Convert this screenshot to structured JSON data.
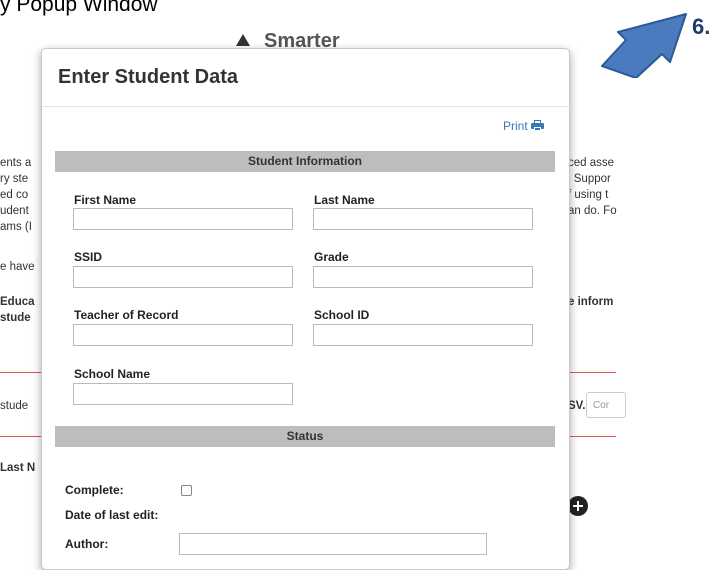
{
  "caption": "y Popup Window",
  "callout": {
    "number": "6."
  },
  "background": {
    "logo": "Smarter",
    "left_fragments": [
      "ents a",
      "ry ste",
      "ed co",
      "udent",
      "ams (I",
      "e have",
      "Educa",
      "stude",
      "stude",
      "Last N"
    ],
    "right_fragments": [
      "ced asse",
      "l Suppor",
      "f using t",
      "an do. Fo",
      "e inform",
      "SV."
    ],
    "input_value": "Cor"
  },
  "modal": {
    "title": "Enter Student Data",
    "print_label": "Print",
    "sections": {
      "student_info": "Student Information",
      "status": "Status"
    },
    "fields": {
      "first_name": "First Name",
      "last_name": "Last Name",
      "ssid": "SSID",
      "grade": "Grade",
      "teacher": "Teacher of Record",
      "school_id": "School ID",
      "school_name": "School Name"
    },
    "status": {
      "complete": "Complete:",
      "last_edit": "Date of last edit:",
      "author": "Author:"
    }
  }
}
